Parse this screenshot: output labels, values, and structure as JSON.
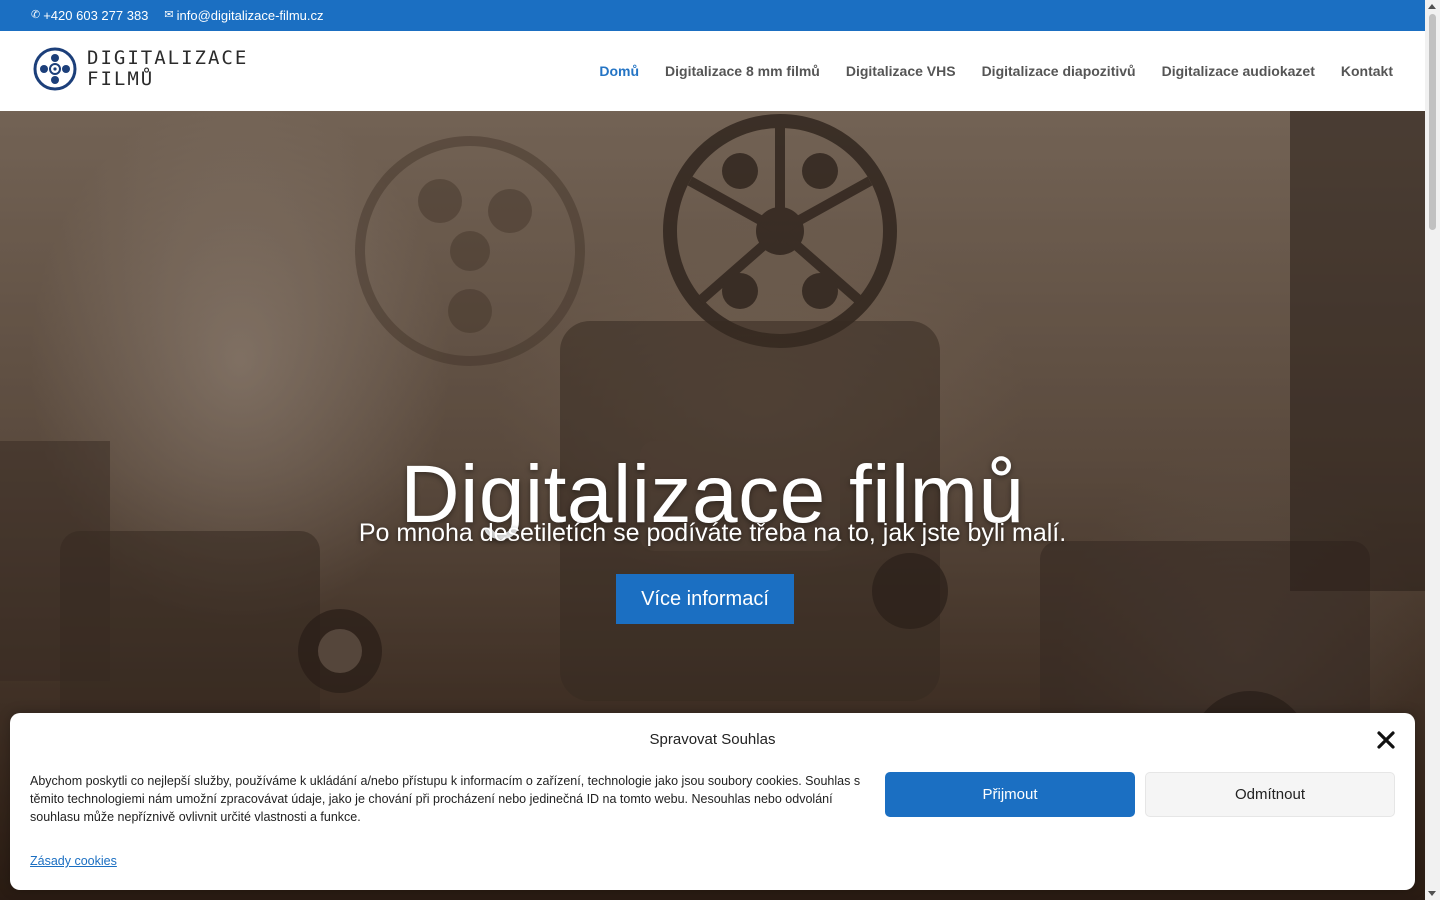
{
  "topbar": {
    "phone": "+420 603 277 383",
    "email": "info@digitalizace-filmu.cz",
    "phone_icon": "phone-icon",
    "email_icon": "envelope-icon",
    "color": "#1b6fc2"
  },
  "logo": {
    "line1": "DIGITALIZACE",
    "line2": "FILMŮ"
  },
  "nav": {
    "items": [
      {
        "label": "Domů",
        "active": true
      },
      {
        "label": "Digitalizace 8 mm filmů",
        "active": false
      },
      {
        "label": "Digitalizace VHS",
        "active": false
      },
      {
        "label": "Digitalizace diapozitivů",
        "active": false
      },
      {
        "label": "Digitalizace audiokazet",
        "active": false
      },
      {
        "label": "Kontakt",
        "active": false
      }
    ],
    "active_color": "#2474c4"
  },
  "hero": {
    "title": "Digitalizace filmů",
    "subtitle": "Po mnoha desetiletích se podíváte třeba na to, jak jste byli malí.",
    "button": "Více informací"
  },
  "cookie": {
    "title": "Spravovat Souhlas",
    "text": "Abychom poskytli co nejlepší služby, používáme k ukládání a/nebo přístupu k informacím o zařízení, technologie jako jsou soubory cookies. Souhlas s těmito technologiemi nám umožní zpracovávat údaje, jako je chování při procházení nebo jedinečná ID na tomto webu. Nesouhlas nebo odvolání souhlasu může nepříznivě ovlivnit určité vlastnosti a funkce.",
    "accept": "Přijmout",
    "deny": "Odmítnout",
    "policy_link": "Zásady cookies",
    "close_icon": "close-icon"
  }
}
